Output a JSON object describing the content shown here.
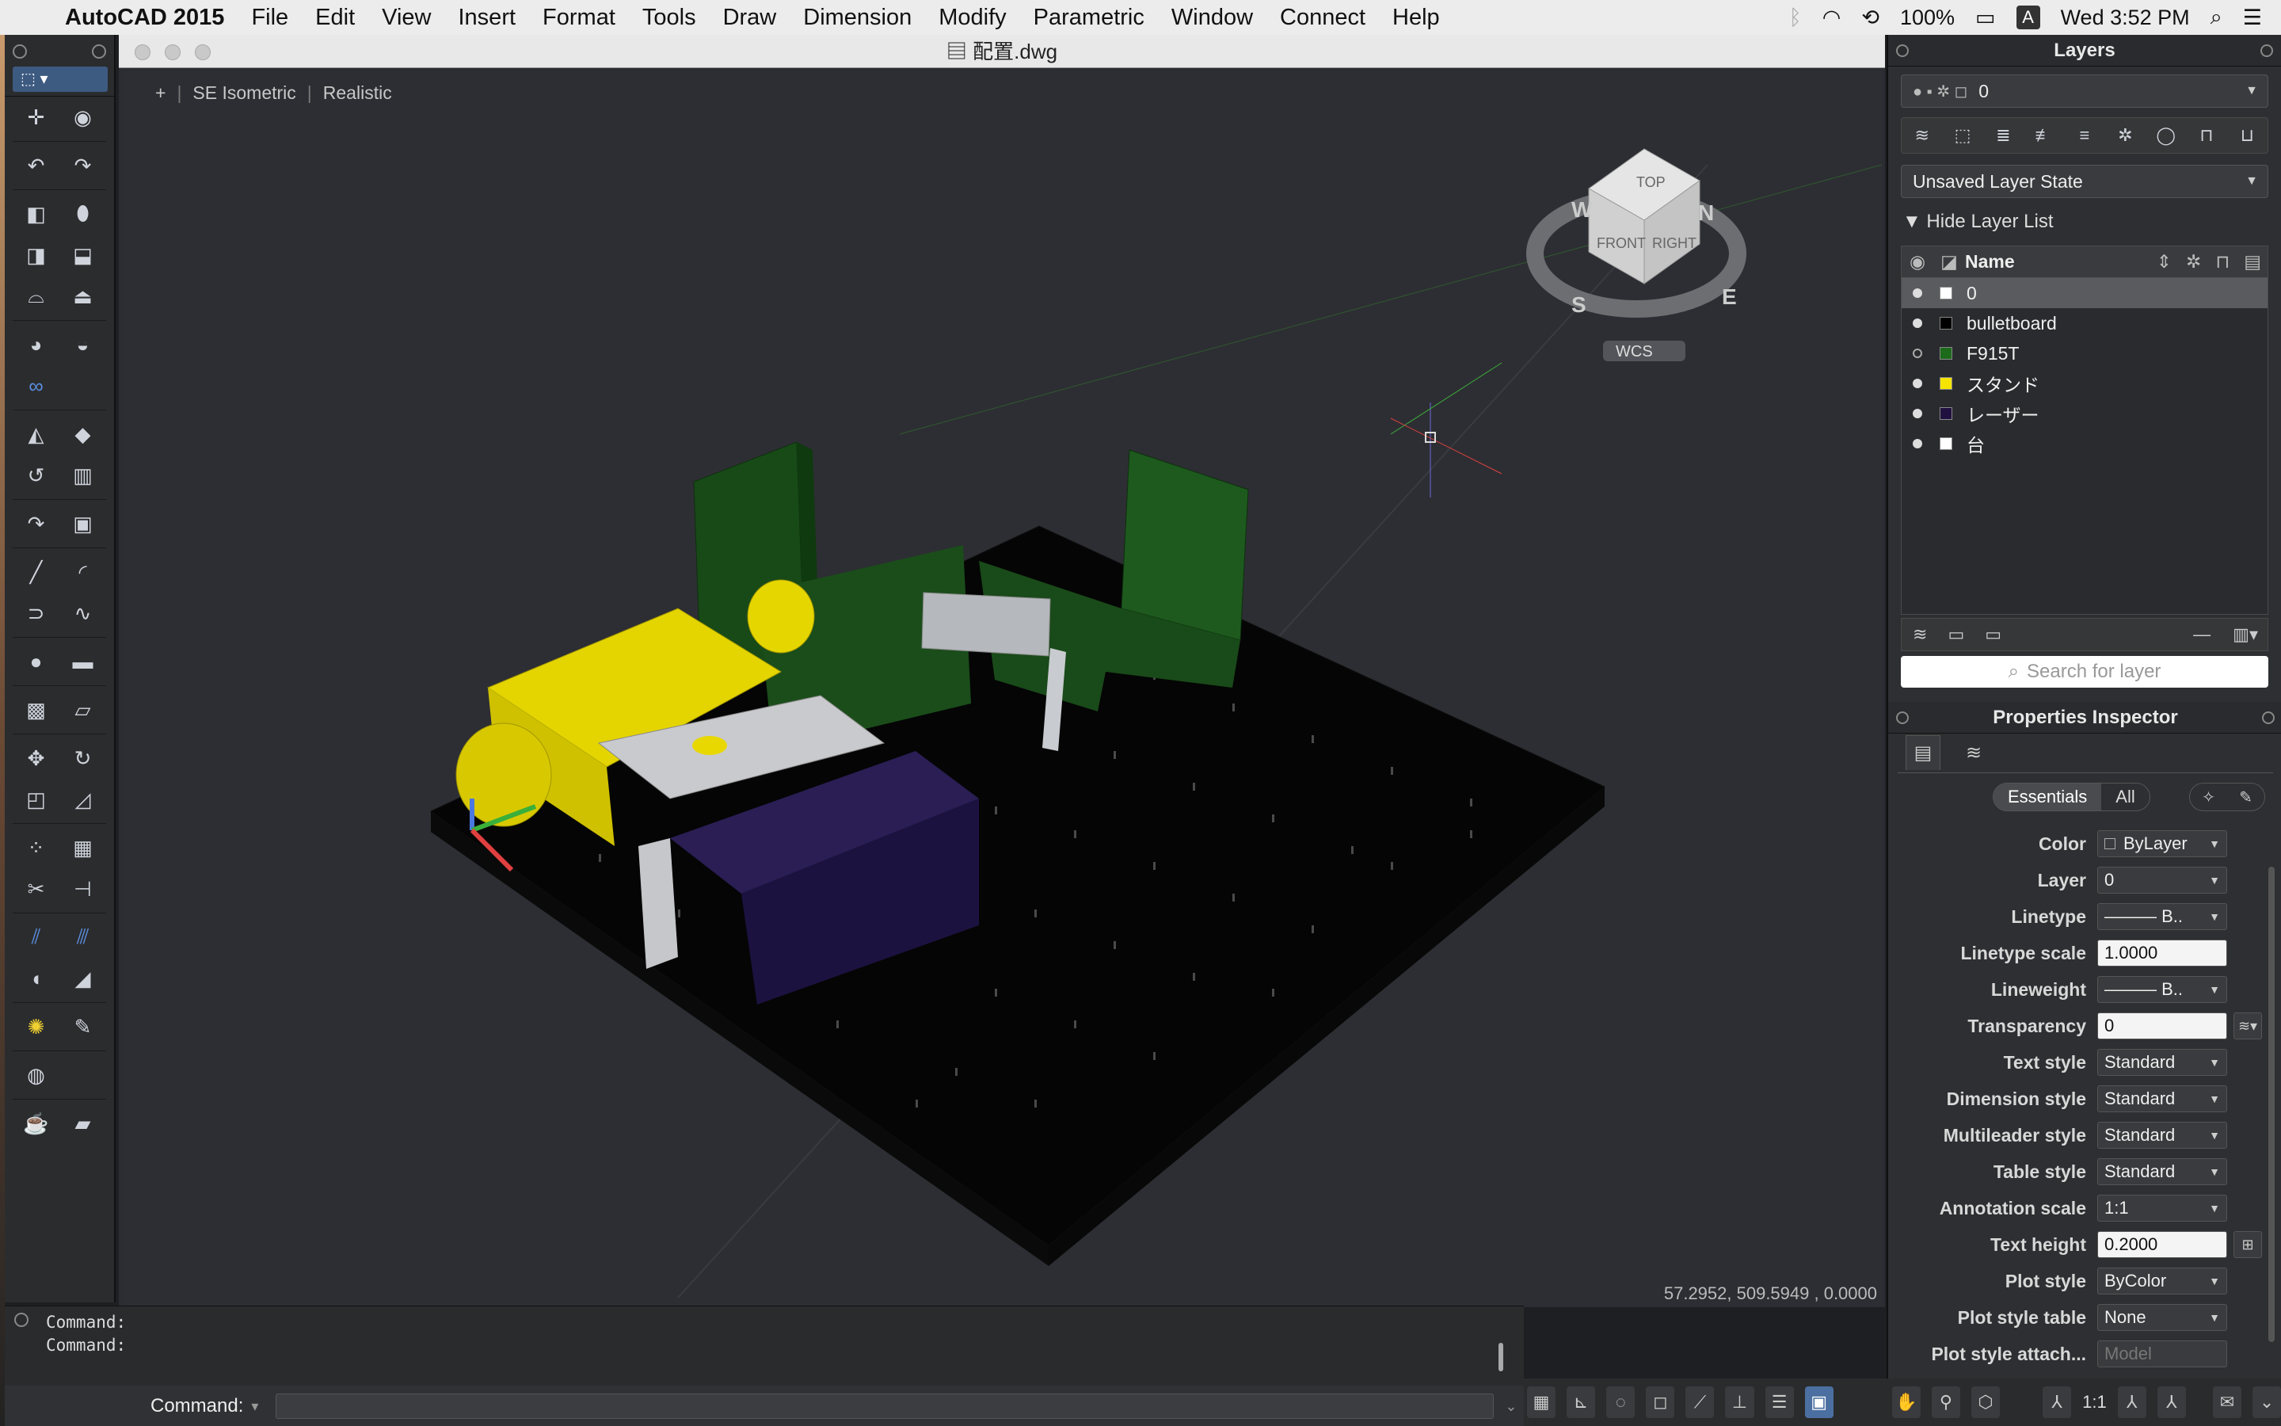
{
  "menubar": {
    "app_name": "AutoCAD 2015",
    "items": [
      "File",
      "Edit",
      "View",
      "Insert",
      "Format",
      "Tools",
      "Draw",
      "Dimension",
      "Modify",
      "Parametric",
      "Window",
      "Connect",
      "Help"
    ],
    "battery": "100%",
    "input_badge": "A",
    "clock": "Wed 3:52 PM"
  },
  "document": {
    "title": "配置.dwg",
    "view_plus": "+",
    "view_name": "SE Isometric",
    "visual_style": "Realistic",
    "viewcube": {
      "top": "TOP",
      "front": "FRONT",
      "right": "RIGHT",
      "n": "N",
      "s": "S",
      "e": "E",
      "w": "W"
    },
    "ucs_label": "WCS",
    "coordinates": "57.2952,  509.5949 , 0.0000"
  },
  "command": {
    "history": [
      "Command:",
      "Command:"
    ],
    "prompt_label": "Command:",
    "input_value": ""
  },
  "status": {
    "scale": "1:1"
  },
  "layers_panel": {
    "title": "Layers",
    "current_layer": "0",
    "layer_state": "Unsaved Layer State",
    "hide_list": "Hide Layer List",
    "column_name": "Name",
    "rows": [
      {
        "name": "0",
        "color": "#ffffff",
        "visible": true,
        "selected": true
      },
      {
        "name": "bulletboard",
        "color": "#000000",
        "visible": true,
        "selected": false
      },
      {
        "name": "F915T",
        "color": "#1b6b1b",
        "visible": false,
        "selected": false
      },
      {
        "name": "スタンド",
        "color": "#f5e400",
        "visible": true,
        "selected": false
      },
      {
        "name": "レーザー",
        "color": "#1f1040",
        "visible": true,
        "selected": false
      },
      {
        "name": "台",
        "color": "#ffffff",
        "visible": true,
        "selected": false
      }
    ],
    "search_placeholder": "Search for layer"
  },
  "properties_panel": {
    "title": "Properties Inspector",
    "tab_essentials": "Essentials",
    "tab_all": "All",
    "rows": [
      {
        "label": "Color",
        "value": "ByLayer",
        "kind": "dropdown",
        "swatch": true
      },
      {
        "label": "Layer",
        "value": "0",
        "kind": "dropdown"
      },
      {
        "label": "Linetype",
        "value": "——— B..",
        "kind": "dropdown"
      },
      {
        "label": "Linetype scale",
        "value": "1.0000",
        "kind": "input"
      },
      {
        "label": "Lineweight",
        "value": "——— B..",
        "kind": "dropdown"
      },
      {
        "label": "Transparency",
        "value": "0",
        "kind": "input"
      },
      {
        "label": "Text style",
        "value": "Standard",
        "kind": "dropdown"
      },
      {
        "label": "Dimension style",
        "value": "Standard",
        "kind": "dropdown"
      },
      {
        "label": "Multileader style",
        "value": "Standard",
        "kind": "dropdown"
      },
      {
        "label": "Table style",
        "value": "Standard",
        "kind": "dropdown"
      },
      {
        "label": "Annotation scale",
        "value": "1:1",
        "kind": "dropdown"
      },
      {
        "label": "Text height",
        "value": "0.2000",
        "kind": "input"
      },
      {
        "label": "Plot style",
        "value": "ByColor",
        "kind": "dropdown"
      },
      {
        "label": "Plot style table",
        "value": "None",
        "kind": "dropdown"
      },
      {
        "label": "Plot style attach...",
        "value": "Model",
        "kind": "dim"
      }
    ]
  }
}
